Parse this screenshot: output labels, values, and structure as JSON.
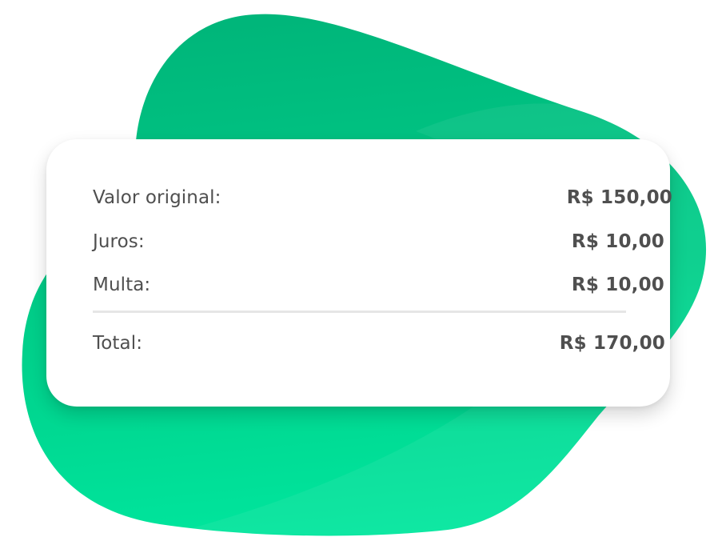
{
  "colors": {
    "accent_dark": "#00b67a",
    "accent_light": "#00e39a",
    "text": "#4f4f4f",
    "divider": "#e6e6e6",
    "card_background": "#ffffff"
  },
  "summary": {
    "rows": [
      {
        "label": "Valor original:",
        "value": "R$ 150,00"
      },
      {
        "label": "Juros:",
        "value": "R$ 10,00"
      },
      {
        "label": "Multa:",
        "value": "R$ 10,00"
      }
    ],
    "total": {
      "label": "Total:",
      "value": "R$ 170,00"
    }
  }
}
